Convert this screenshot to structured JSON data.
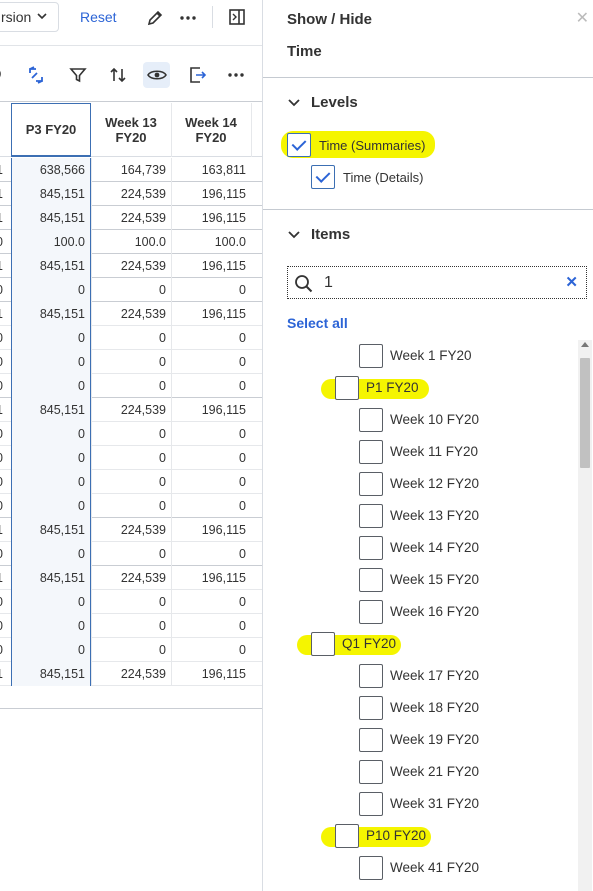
{
  "toolbar": {
    "version_label": "rsion",
    "reset_label": "Reset"
  },
  "grid": {
    "headers": [
      "P3 FY20",
      "Week 13 FY20",
      "Week 14 FY20"
    ],
    "rows": [
      {
        "c0": "1",
        "c1": "638,566",
        "c2": "164,739",
        "c3": "163,811"
      },
      {
        "c0": "1",
        "c1": "845,151",
        "c2": "224,539",
        "c3": "196,115"
      },
      {
        "c0": "1",
        "c1": "845,151",
        "c2": "224,539",
        "c3": "196,115"
      },
      {
        "c0": "0",
        "c1": "100.0",
        "c2": "100.0",
        "c3": "100.0"
      },
      {
        "c0": "1",
        "c1": "845,151",
        "c2": "224,539",
        "c3": "196,115"
      },
      {
        "c0": "0",
        "c1": "0",
        "c2": "0",
        "c3": "0"
      },
      {
        "c0": "1",
        "c1": "845,151",
        "c2": "224,539",
        "c3": "196,115"
      },
      {
        "c0": "0",
        "c1": "0",
        "c2": "0",
        "c3": "0"
      },
      {
        "c0": "0",
        "c1": "0",
        "c2": "0",
        "c3": "0"
      },
      {
        "c0": "0",
        "c1": "0",
        "c2": "0",
        "c3": "0"
      },
      {
        "c0": "1",
        "c1": "845,151",
        "c2": "224,539",
        "c3": "196,115"
      },
      {
        "c0": "0",
        "c1": "0",
        "c2": "0",
        "c3": "0"
      },
      {
        "c0": "0",
        "c1": "0",
        "c2": "0",
        "c3": "0"
      },
      {
        "c0": "0",
        "c1": "0",
        "c2": "0",
        "c3": "0"
      },
      {
        "c0": "0",
        "c1": "0",
        "c2": "0",
        "c3": "0"
      },
      {
        "c0": "1",
        "c1": "845,151",
        "c2": "224,539",
        "c3": "196,115"
      },
      {
        "c0": "0",
        "c1": "0",
        "c2": "0",
        "c3": "0"
      },
      {
        "c0": "1",
        "c1": "845,151",
        "c2": "224,539",
        "c3": "196,115"
      },
      {
        "c0": "0",
        "c1": "0",
        "c2": "0",
        "c3": "0"
      },
      {
        "c0": "0",
        "c1": "0",
        "c2": "0",
        "c3": "0"
      },
      {
        "c0": "0",
        "c1": "0",
        "c2": "0",
        "c3": "0"
      },
      {
        "c0": "1",
        "c1": "845,151",
        "c2": "224,539",
        "c3": "196,115"
      }
    ]
  },
  "panel": {
    "title": "Show / Hide",
    "subtitle": "Time",
    "levels": {
      "heading": "Levels",
      "options": [
        {
          "label": "Time (Summaries)",
          "checked": true
        },
        {
          "label": "Time (Details)",
          "checked": true
        }
      ]
    },
    "items": {
      "heading": "Items",
      "search_value": "1",
      "select_all": "Select all",
      "list": [
        {
          "label": "Week 1 FY20",
          "level": 1
        },
        {
          "label": "P1 FY20",
          "level": 0
        },
        {
          "label": "Week 10 FY20",
          "level": 1
        },
        {
          "label": "Week 11 FY20",
          "level": 1
        },
        {
          "label": "Week 12 FY20",
          "level": 1
        },
        {
          "label": "Week 13 FY20",
          "level": 1
        },
        {
          "label": "Week 14 FY20",
          "level": 1
        },
        {
          "label": "Week 15 FY20",
          "level": 1
        },
        {
          "label": "Week 16 FY20",
          "level": 1
        },
        {
          "label": "Q1 FY20",
          "level": -1
        },
        {
          "label": "Week 17 FY20",
          "level": 1
        },
        {
          "label": "Week 18 FY20",
          "level": 1
        },
        {
          "label": "Week 19 FY20",
          "level": 1
        },
        {
          "label": "Week 21 FY20",
          "level": 1
        },
        {
          "label": "Week 31 FY20",
          "level": 1
        },
        {
          "label": "P10 FY20",
          "level": 0
        },
        {
          "label": "Week 41 FY20",
          "level": 1
        }
      ]
    }
  },
  "colors": {
    "accent": "#2c64d6",
    "highlight": "#f5f500",
    "selected_column_border": "#3c6fb3"
  }
}
